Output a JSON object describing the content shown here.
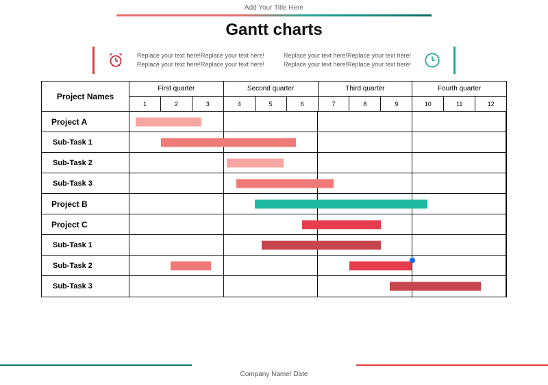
{
  "header": {
    "caption": "Add Your Title Here",
    "title": "Gantt charts"
  },
  "info": {
    "left_col": {
      "line1": "Replace your text here!Replace your text here!",
      "line2": "Replace your text here!Replace your text here!"
    },
    "right_col": {
      "line1": "Replace your text here!Replace your text here!",
      "line2": "Replace your text here!Replace your text here!"
    }
  },
  "columns": {
    "name_header": "Project Names",
    "quarters": [
      "First quarter",
      "Second quarter",
      "Third quarter",
      "Fourth quarter"
    ],
    "months": [
      "1",
      "2",
      "3",
      "4",
      "5",
      "6",
      "7",
      "8",
      "9",
      "10",
      "11",
      "12"
    ]
  },
  "rows": [
    {
      "label": "Project A",
      "kind": "project"
    },
    {
      "label": "Sub-Task 1",
      "kind": "sub"
    },
    {
      "label": "Sub-Task 2",
      "kind": "sub"
    },
    {
      "label": "Sub-Task 3",
      "kind": "sub"
    },
    {
      "label": "Project B",
      "kind": "project"
    },
    {
      "label": "Project C",
      "kind": "project"
    },
    {
      "label": "Sub-Task 1",
      "kind": "sub"
    },
    {
      "label": "Sub-Task 2",
      "kind": "sub"
    },
    {
      "label": "Sub-Task 3",
      "kind": "sub"
    }
  ],
  "footer": {
    "text": "Company Name/ Date"
  },
  "colors": {
    "red_soft": "#f6a7a2",
    "red_med": "#f07a78",
    "red_strong": "#e73c4e",
    "red_dark": "#c7454d",
    "teal": "#1fb9a1",
    "blue_dot": "#1766ff"
  },
  "chart_data": {
    "type": "gantt",
    "x_unit": "month",
    "x_range": [
      1,
      12
    ],
    "title": "Gantt charts",
    "series": [
      {
        "name": "Project A",
        "start": 1.2,
        "end": 3.3,
        "color": "red_soft"
      },
      {
        "name": "Sub-Task 1",
        "start": 2.0,
        "end": 6.3,
        "color": "red_med"
      },
      {
        "name": "Sub-Task 2",
        "start": 4.1,
        "end": 5.9,
        "color": "red_soft"
      },
      {
        "name": "Sub-Task 3",
        "start": 4.4,
        "end": 7.5,
        "color": "red_med"
      },
      {
        "name": "Project B",
        "start": 5.0,
        "end": 10.5,
        "color": "teal"
      },
      {
        "name": "Project C",
        "start": 6.5,
        "end": 9.0,
        "color": "red_strong"
      },
      {
        "name": "Sub-Task 1",
        "start": 5.2,
        "end": 9.0,
        "color": "red_dark"
      },
      {
        "name": "Sub-Task 2",
        "segments": [
          {
            "start": 2.3,
            "end": 3.6,
            "color": "red_med"
          },
          {
            "start": 8.0,
            "end": 10.0,
            "color": "red_strong",
            "marker_at": 10.0
          }
        ]
      },
      {
        "name": "Sub-Task 3",
        "start": 9.3,
        "end": 12.2,
        "color": "red_dark"
      }
    ]
  }
}
